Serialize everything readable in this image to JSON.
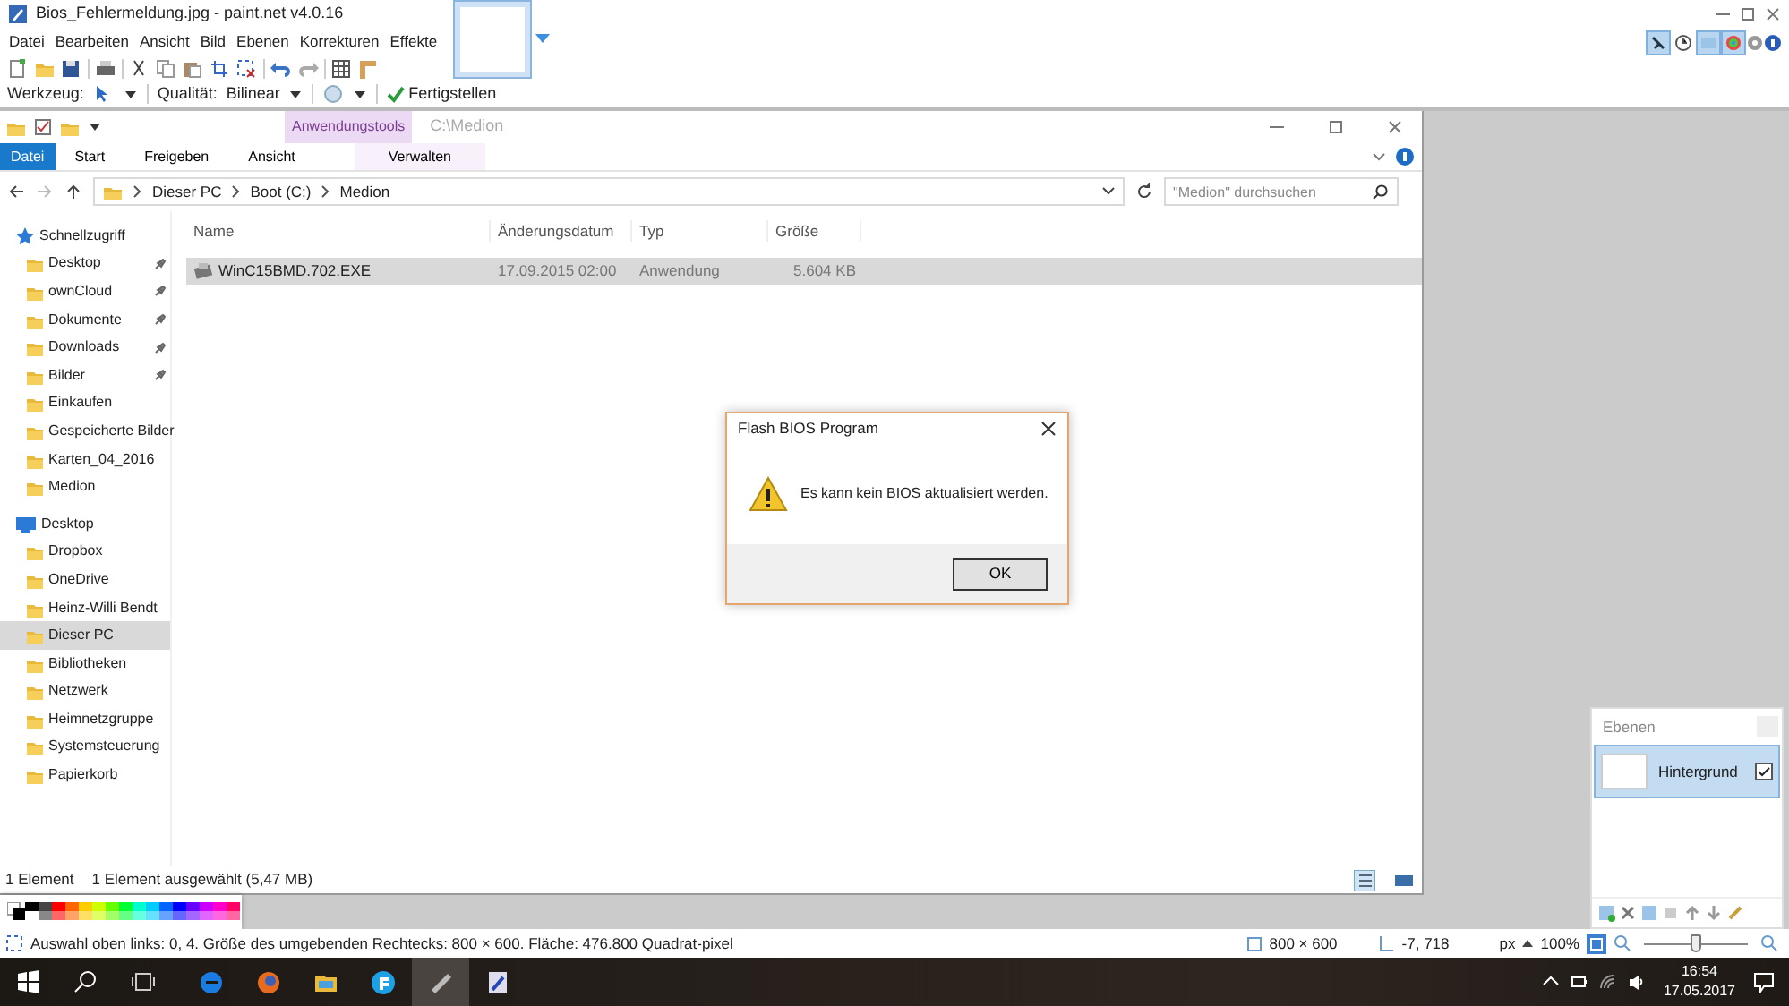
{
  "app": {
    "title": "Bios_Fehlermeldung.jpg - paint.net v4.0.16",
    "menu": [
      "Datei",
      "Bearbeiten",
      "Ansicht",
      "Bild",
      "Ebenen",
      "Korrekturen",
      "Effekte"
    ],
    "window_toggles": [
      {
        "on": true
      },
      {
        "on": false
      },
      {
        "on": true
      },
      {
        "on": true
      }
    ]
  },
  "tool_options": {
    "tool_label": "Werkzeug:",
    "quality_label": "Qualität:",
    "quality_value": "Bilinear",
    "finish": "Fertigstellen"
  },
  "explorer": {
    "context_tab": "Anwendungstools",
    "path_title": "C:\\Medion",
    "tabs": [
      {
        "label": "Datei",
        "kind": "file"
      },
      {
        "label": "Start",
        "kind": "normal"
      },
      {
        "label": "Freigeben",
        "kind": "normal"
      },
      {
        "label": "Ansicht",
        "kind": "normal"
      },
      {
        "label": "Verwalten",
        "kind": "context"
      }
    ],
    "breadcrumb": [
      "Dieser PC",
      "Boot (C:)",
      "Medion"
    ],
    "search": {
      "placeholder": "\"Medion\" durchsuchen"
    },
    "sidebar": [
      {
        "label": "Schnellzugriff",
        "selected": false,
        "children": [
          {
            "label": "Desktop",
            "pinned": true,
            "selected": false
          },
          {
            "label": "ownCloud",
            "pinned": true,
            "selected": false
          },
          {
            "label": "Dokumente",
            "pinned": true,
            "selected": false
          },
          {
            "label": "Downloads",
            "pinned": true,
            "selected": false
          },
          {
            "label": "Bilder",
            "pinned": true,
            "selected": false
          },
          {
            "label": "Einkaufen",
            "pinned": false,
            "selected": false
          },
          {
            "label": "Gespeicherte Bilder",
            "pinned": false,
            "selected": false
          },
          {
            "label": "Karten_04_2016",
            "pinned": false,
            "selected": false
          },
          {
            "label": "Medion",
            "pinned": false,
            "selected": false
          }
        ]
      },
      {
        "label": "Desktop",
        "selected": false,
        "children": [
          {
            "label": "Dropbox",
            "pinned": false,
            "selected": false
          },
          {
            "label": "OneDrive",
            "pinned": false,
            "selected": false
          },
          {
            "label": "Heinz-Willi Bendt",
            "pinned": false,
            "selected": false
          },
          {
            "label": "Dieser PC",
            "pinned": false,
            "selected": true
          },
          {
            "label": "Bibliotheken",
            "pinned": false,
            "selected": false
          },
          {
            "label": "Netzwerk",
            "pinned": false,
            "selected": false
          },
          {
            "label": "Heimnetzgruppe",
            "pinned": false,
            "selected": false
          },
          {
            "label": "Systemsteuerung",
            "pinned": false,
            "selected": false
          },
          {
            "label": "Papierkorb",
            "pinned": false,
            "selected": false
          }
        ]
      }
    ],
    "columns": [
      "Name",
      "Änderungsdatum",
      "Typ",
      "Größe"
    ],
    "rows": [
      {
        "cells": [
          "WinC15BMD.702.EXE",
          "17.09.2015 02:00",
          "Anwendung",
          "5.604 KB"
        ],
        "selected": true
      }
    ],
    "status": [
      "1 Element",
      "1 Element ausgewählt (5,47 MB)"
    ]
  },
  "dialog": {
    "title": "Flash BIOS Program",
    "message": "Es kann kein BIOS aktualisiert werden.",
    "button": "OK"
  },
  "layers": {
    "title": "Ebenen",
    "items": [
      {
        "name": "Hintergrund",
        "selected": true,
        "visible": true
      }
    ]
  },
  "status_bar": {
    "selection": "Auswahl oben links: 0, 4. Größe des umgebenden Rechtecks: 800 × 600. Fläche: 476.800 Quadrat-pixel",
    "image_size": "800 × 600",
    "cursor": "-7, 718",
    "unit": "px",
    "zoom": "100%",
    "zoom_slider": {
      "level": 0.5
    }
  },
  "taskbar": {
    "time": "16:54",
    "date": "17.05.2017"
  }
}
